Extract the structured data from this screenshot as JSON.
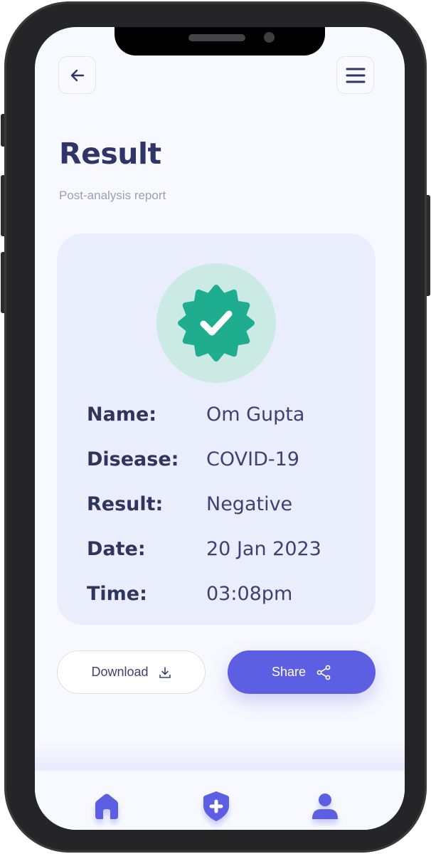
{
  "header": {
    "back_icon": "arrow-left-icon",
    "menu_icon": "hamburger-menu-icon",
    "title": "Result",
    "subtitle": "Post-analysis report"
  },
  "result_card": {
    "badge_icon": "verified-check-badge-icon",
    "rows": [
      {
        "label": "Name:",
        "value": "Om Gupta"
      },
      {
        "label": "Disease:",
        "value": "COVID-19"
      },
      {
        "label": "Result:",
        "value": "Negative"
      },
      {
        "label": "Date:",
        "value": "20 Jan 2023"
      },
      {
        "label": "Time:",
        "value": "03:08pm"
      }
    ]
  },
  "actions": {
    "download_label": "Download",
    "download_icon": "download-icon",
    "share_label": "Share",
    "share_icon": "share-icon"
  },
  "bottom_nav": {
    "items": [
      {
        "icon": "home-icon"
      },
      {
        "icon": "shield-plus-icon"
      },
      {
        "icon": "user-icon"
      }
    ]
  },
  "colors": {
    "accent": "#5c5fe1",
    "title": "#2f3569",
    "badge_green": "#1eae8f",
    "card_bg": "#eaeefc"
  }
}
